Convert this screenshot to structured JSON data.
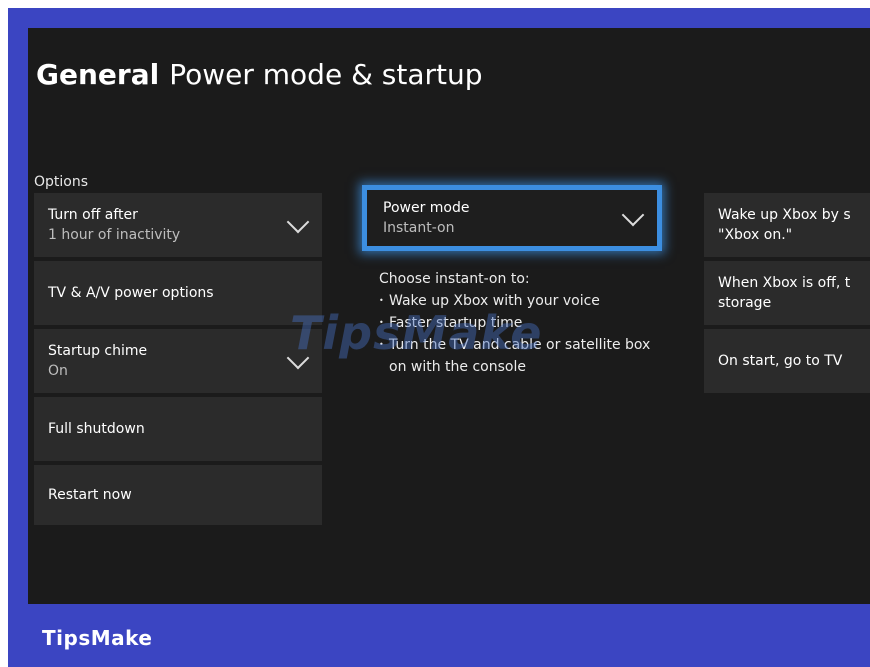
{
  "header": {
    "section": "General",
    "page": "Power mode & startup"
  },
  "options": {
    "label": "Options",
    "turn_off": {
      "title": "Turn off after",
      "value": "1 hour of inactivity"
    },
    "tv_av": {
      "title": "TV & A/V power options"
    },
    "startup_chime": {
      "title": "Startup chime",
      "value": "On"
    },
    "full_shutdown": {
      "title": "Full shutdown"
    },
    "restart": {
      "title": "Restart now"
    }
  },
  "power_mode": {
    "title": "Power mode",
    "value": "Instant-on",
    "description_heading": "Choose instant-on to:",
    "bullets": [
      "Wake up Xbox with your voice",
      "Faster startup time",
      "Turn the TV and cable or satellite box on with the console"
    ]
  },
  "right_column": {
    "wake_up": "Wake up Xbox by s\n\"Xbox on.\"",
    "wake_up_line1": "Wake up Xbox by s",
    "wake_up_line2": "\"Xbox on.\"",
    "when_off_line1": "When Xbox is off, t",
    "when_off_line2": "storage",
    "on_start": "On start, go to TV"
  },
  "watermark": "TipsMake",
  "brand": "TipsMake",
  "colors": {
    "frame": "#3b45c2",
    "screen": "#1b1b1b",
    "tile": "#2b2b2b",
    "focus": "#3c8ee0"
  },
  "icons": {
    "dropdown": "chevron-down-icon"
  }
}
